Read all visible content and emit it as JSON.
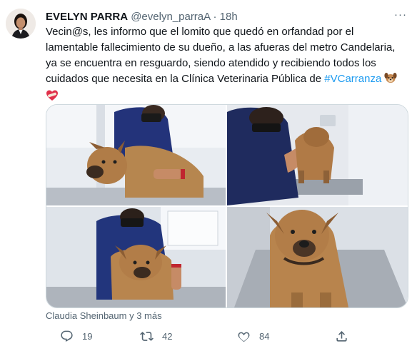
{
  "colors": {
    "text_primary": "#0f1419",
    "text_secondary": "#536471",
    "link": "#1d9bf0",
    "border": "#cfd9de",
    "background": "#ffffff"
  },
  "tweet": {
    "author": {
      "name": "EVELYN PARRA",
      "handle": "@evelyn_parraA",
      "separator": "·",
      "time": "18h"
    },
    "more_icon": "ellipsis-icon",
    "text": "Vecin@s, les informo que el lomito que quedó en orfandad por el lamentable fallecimiento de su dueño, a las afueras del metro Candelaria, ya se encuentra en resguardo, siendo atendido y recibiendo todos los cuidados que necesita en la Clínica Veterinaria Pública de",
    "hashtag": "#VCarranza",
    "emojis": [
      "dog-face-emoji",
      "heart-bandage-emoji"
    ],
    "media": {
      "photos": [
        {
          "icon": "photo-vet-with-dog-1"
        },
        {
          "icon": "photo-vet-with-dog-2"
        },
        {
          "icon": "photo-vet-with-dog-3"
        },
        {
          "icon": "photo-dog-closeup"
        }
      ]
    },
    "social_context": "Claudia Sheinbaum y 3 más",
    "actions": {
      "reply": {
        "icon": "reply-icon",
        "count": "19"
      },
      "retweet": {
        "icon": "retweet-icon",
        "count": "42"
      },
      "like": {
        "icon": "heart-icon",
        "count": "84"
      },
      "share": {
        "icon": "share-icon"
      }
    }
  }
}
